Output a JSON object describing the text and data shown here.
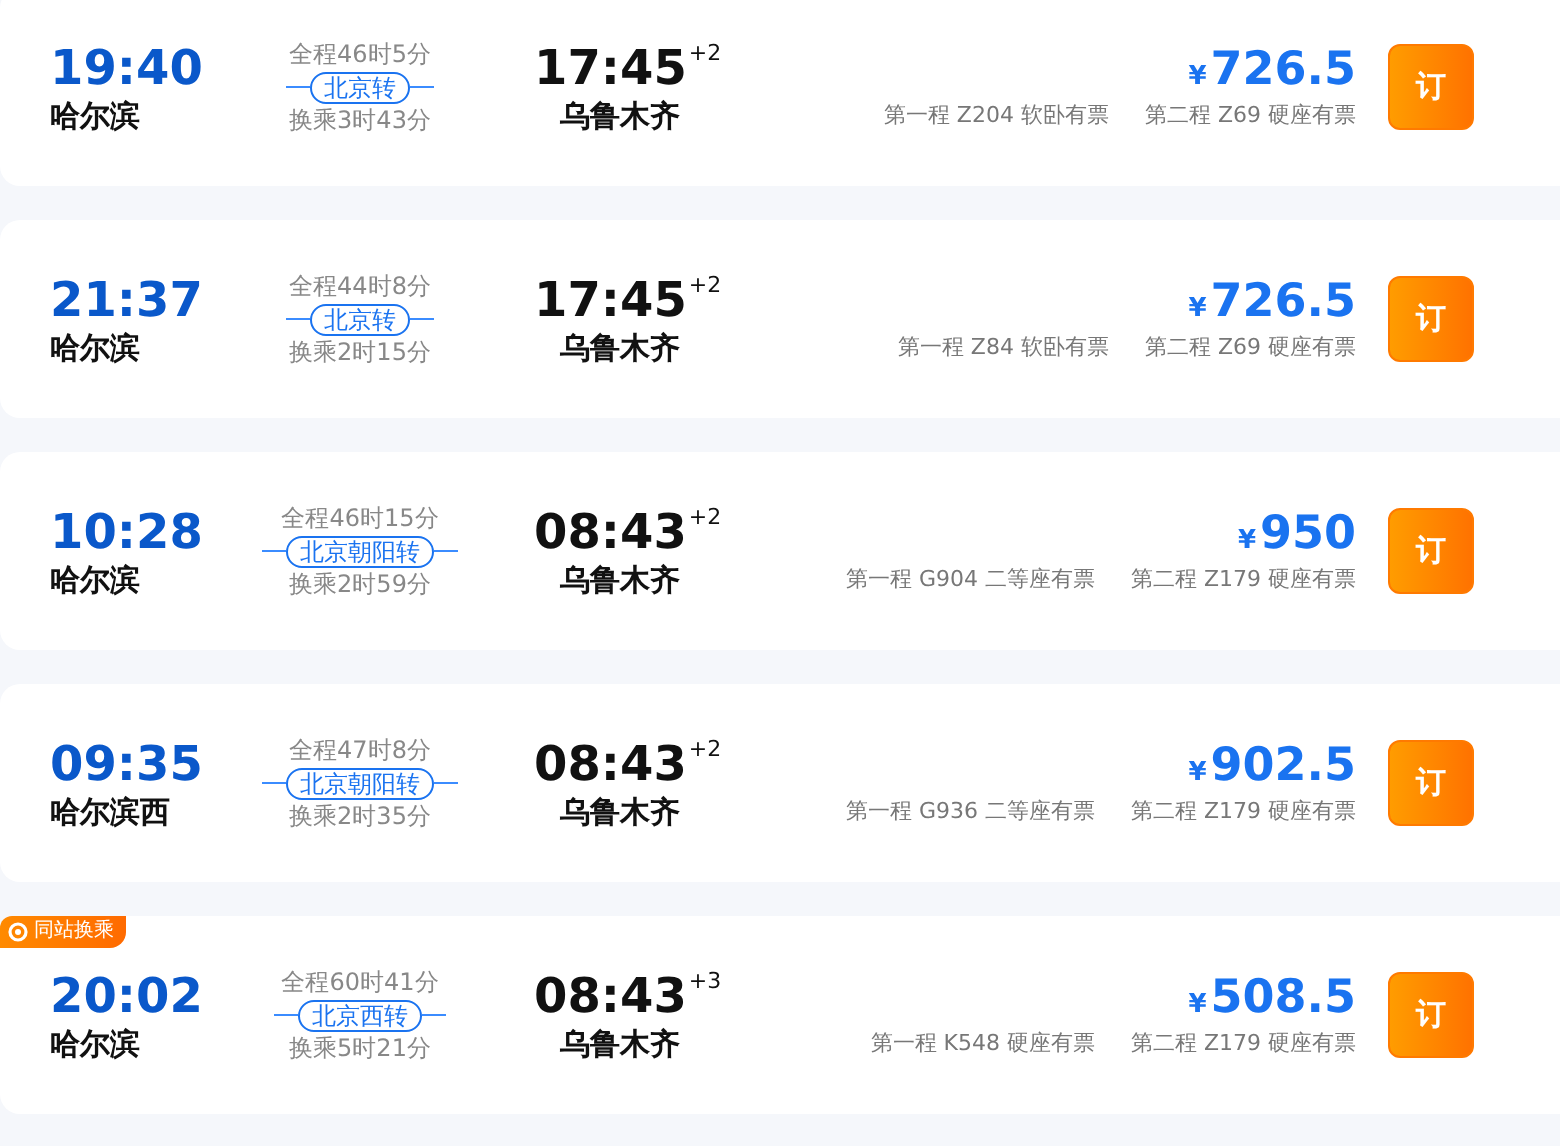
{
  "trips": [
    {
      "depart_time": "19:40",
      "depart_station": "哈尔滨",
      "duration": "全程46时5分",
      "transfer": "北京转",
      "wait": "换乘3时43分",
      "arrive_time": "17:45",
      "day_offset": "+2",
      "arrive_station": "乌鲁木齐",
      "currency": "¥",
      "price": "726.5",
      "legs": [
        "第一程 Z204 软卧有票",
        "第二程 Z69 硬座有票"
      ],
      "book": "订"
    },
    {
      "depart_time": "21:37",
      "depart_station": "哈尔滨",
      "duration": "全程44时8分",
      "transfer": "北京转",
      "wait": "换乘2时15分",
      "arrive_time": "17:45",
      "day_offset": "+2",
      "arrive_station": "乌鲁木齐",
      "currency": "¥",
      "price": "726.5",
      "legs": [
        "第一程 Z84 软卧有票",
        "第二程 Z69 硬座有票"
      ],
      "book": "订"
    },
    {
      "depart_time": "10:28",
      "depart_station": "哈尔滨",
      "duration": "全程46时15分",
      "transfer": "北京朝阳转",
      "wait": "换乘2时59分",
      "arrive_time": "08:43",
      "day_offset": "+2",
      "arrive_station": "乌鲁木齐",
      "currency": "¥",
      "price": "950",
      "legs": [
        "第一程 G904 二等座有票",
        "第二程 Z179 硬座有票"
      ],
      "book": "订"
    },
    {
      "depart_time": "09:35",
      "depart_station": "哈尔滨西",
      "duration": "全程47时8分",
      "transfer": "北京朝阳转",
      "wait": "换乘2时35分",
      "arrive_time": "08:43",
      "day_offset": "+2",
      "arrive_station": "乌鲁木齐",
      "currency": "¥",
      "price": "902.5",
      "legs": [
        "第一程 G936 二等座有票",
        "第二程 Z179 硬座有票"
      ],
      "book": "订"
    },
    {
      "badge": "同站换乘",
      "depart_time": "20:02",
      "depart_station": "哈尔滨",
      "duration": "全程60时41分",
      "transfer": "北京西转",
      "wait": "换乘5时21分",
      "arrive_time": "08:43",
      "day_offset": "+3",
      "arrive_station": "乌鲁木齐",
      "currency": "¥",
      "price": "508.5",
      "legs": [
        "第一程 K548 硬座有票",
        "第二程 Z179 硬座有票"
      ],
      "book": "订"
    }
  ]
}
